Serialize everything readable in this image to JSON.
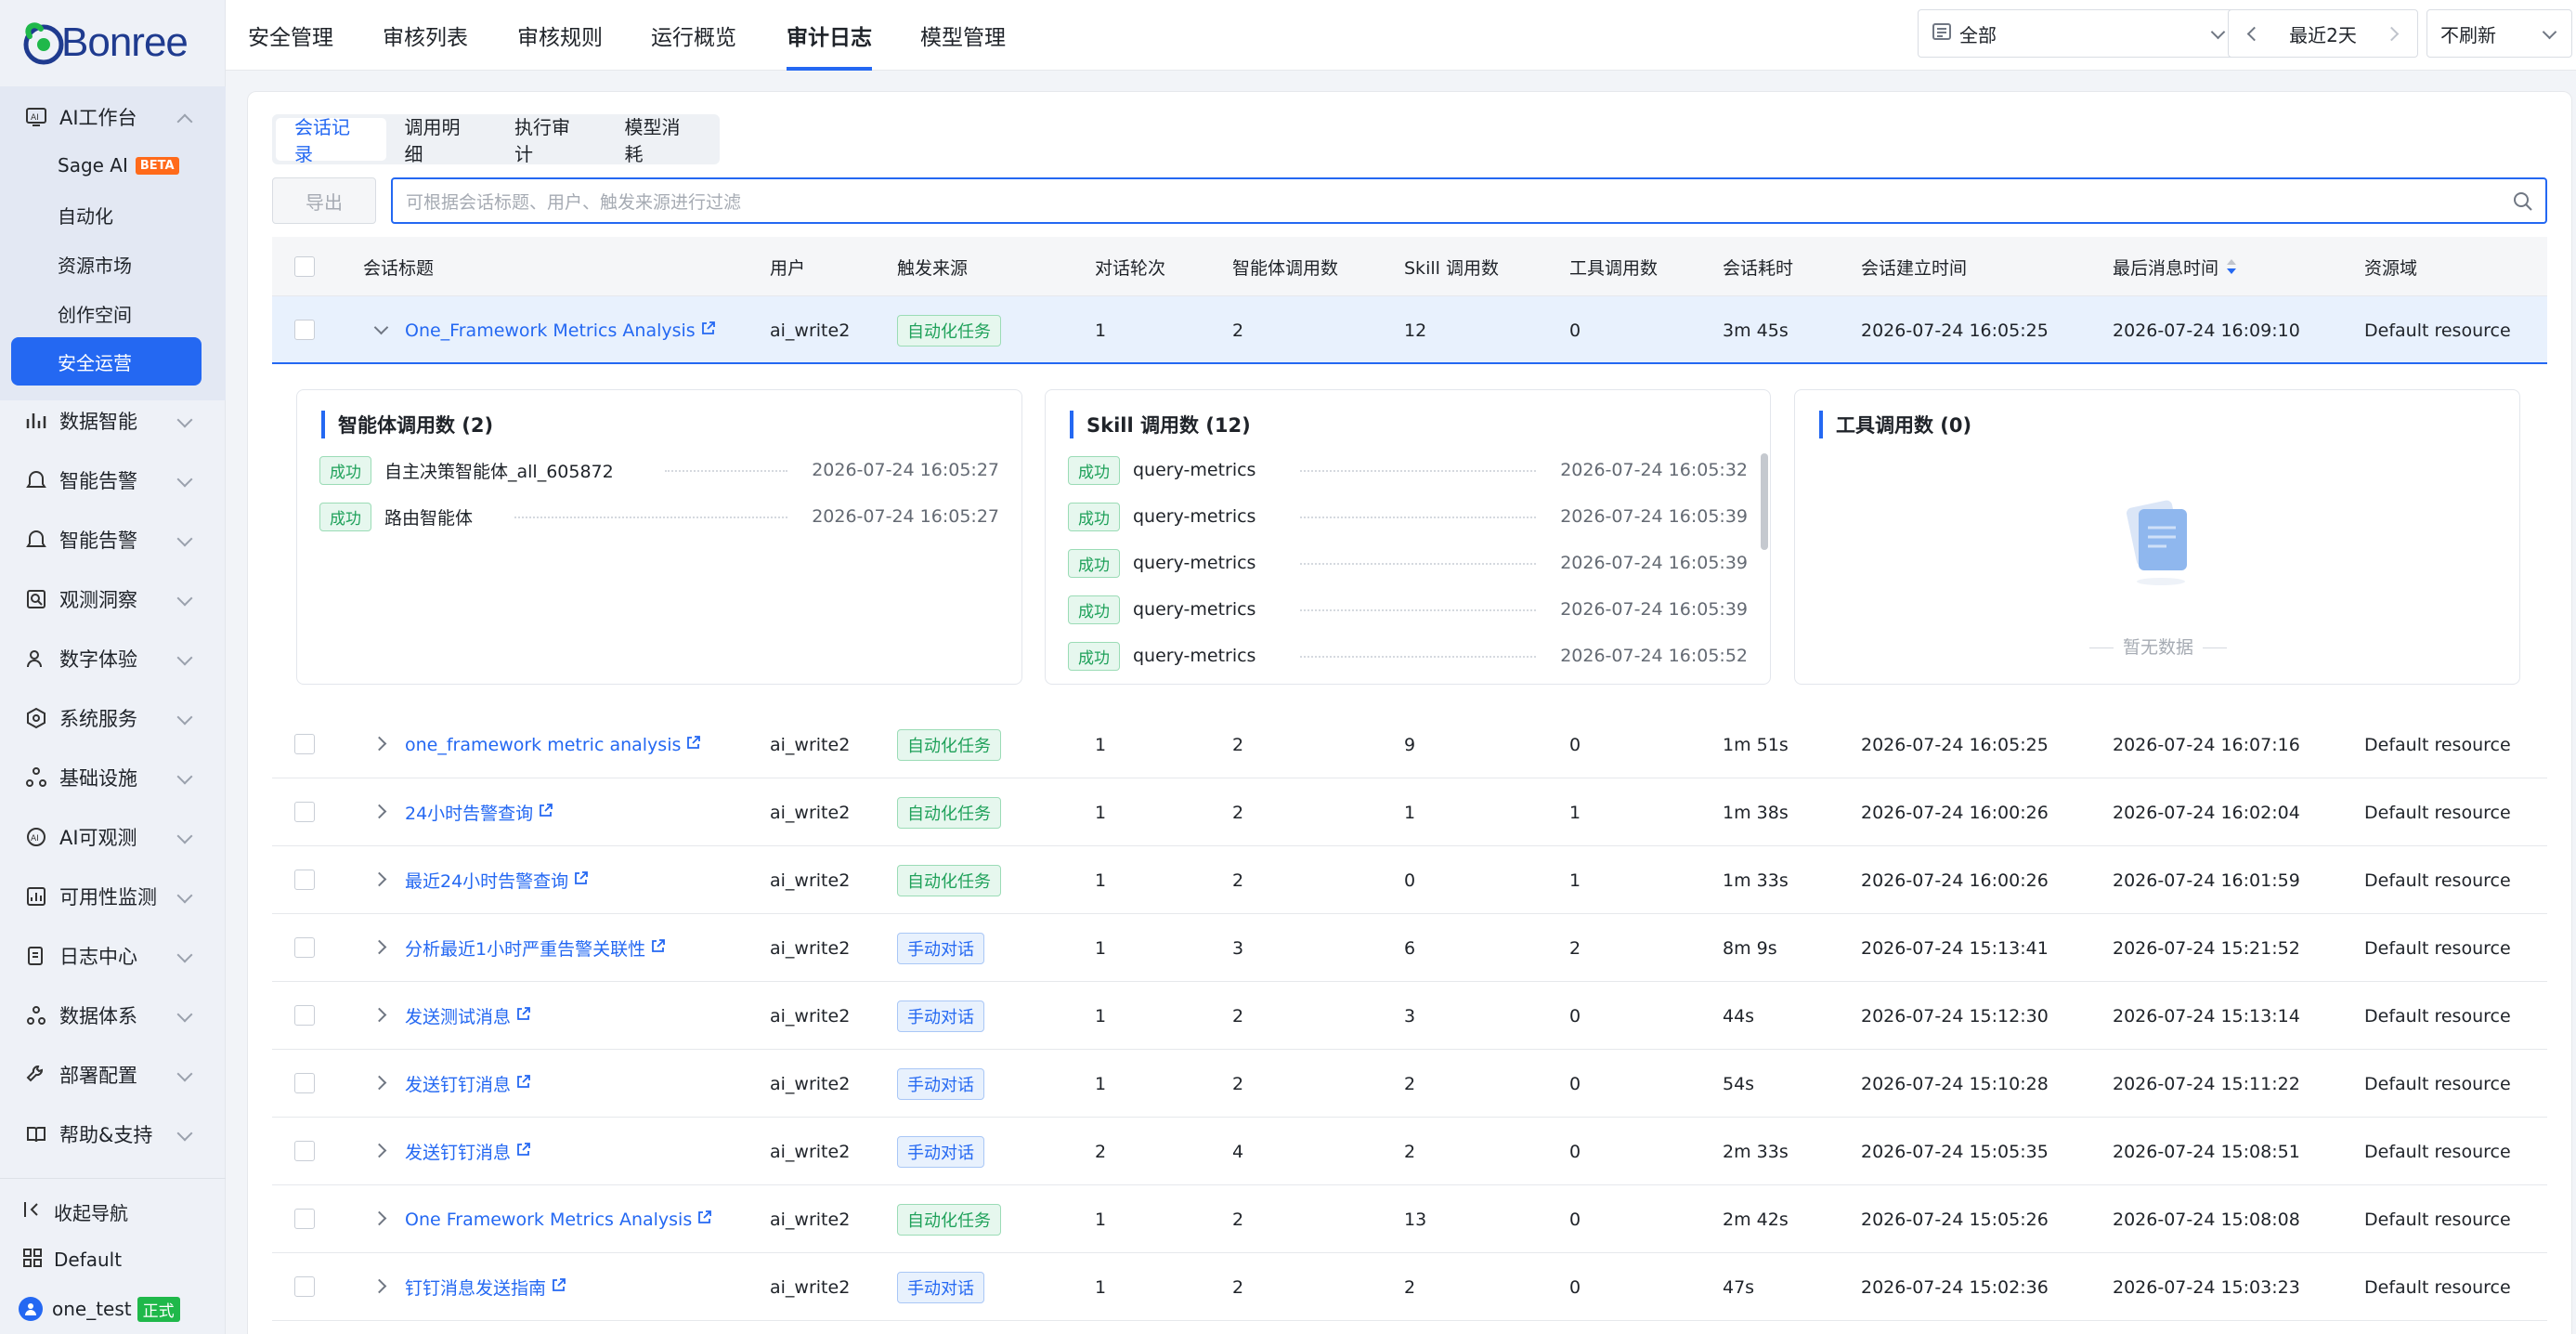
{
  "brand": {
    "name": "Bonree"
  },
  "sidebar": {
    "groups": [
      {
        "label": "AI工作台",
        "icon": "ai-workbench-icon",
        "expanded": true
      },
      {
        "label": "数据智能",
        "icon": "data-intel-icon"
      },
      {
        "label": "智能告警",
        "icon": "alert-icon"
      },
      {
        "label": "智能告警",
        "icon": "alert-icon"
      },
      {
        "label": "观测洞察",
        "icon": "insight-icon"
      },
      {
        "label": "数字体验",
        "icon": "digital-exp-icon"
      },
      {
        "label": "系统服务",
        "icon": "system-icon"
      },
      {
        "label": "基础设施",
        "icon": "infra-icon"
      },
      {
        "label": "AI可观测",
        "icon": "ai-observe-icon"
      },
      {
        "label": "可用性监测",
        "icon": "availability-icon"
      },
      {
        "label": "日志中心",
        "icon": "log-icon"
      },
      {
        "label": "数据体系",
        "icon": "data-system-icon"
      },
      {
        "label": "部署配置",
        "icon": "deploy-icon"
      },
      {
        "label": "帮助&支持",
        "icon": "help-icon"
      }
    ],
    "sub_items": [
      {
        "label": "Sage AI",
        "badge": "BETA"
      },
      {
        "label": "自动化"
      },
      {
        "label": "资源市场"
      },
      {
        "label": "创作空间"
      },
      {
        "label": "安全运营",
        "active": true
      }
    ],
    "collapse_label": "收起导航",
    "workspace_label": "Default",
    "user": {
      "name": "one_test",
      "badge": "正式"
    }
  },
  "topnav": {
    "tabs": [
      {
        "label": "安全管理"
      },
      {
        "label": "审核列表"
      },
      {
        "label": "审核规则"
      },
      {
        "label": "运行概览"
      },
      {
        "label": "审计日志",
        "active": true
      },
      {
        "label": "模型管理"
      }
    ],
    "scope_select": "全部",
    "time_range": "最近2天",
    "refresh_select": "不刷新"
  },
  "subtabs": [
    {
      "label": "会话记录",
      "active": true
    },
    {
      "label": "调用明细"
    },
    {
      "label": "执行审计"
    },
    {
      "label": "模型消耗"
    }
  ],
  "toolbar": {
    "export_label": "导出",
    "search_placeholder": "可根据会话标题、用户、触发来源进行过滤"
  },
  "table": {
    "columns": [
      "会话标题",
      "用户",
      "触发来源",
      "对话轮次",
      "智能体调用数",
      "Skill 调用数",
      "工具调用数",
      "会话耗时",
      "会话建立时间",
      "最后消息时间",
      "资源域"
    ],
    "sorted_column": "最后消息时间",
    "rows": [
      {
        "title": "One_Framework Metrics Analysis",
        "user": "ai_write2",
        "source": "自动化任务",
        "source_type": "auto",
        "turns": "1",
        "agents": "2",
        "skills": "12",
        "tools": "0",
        "duration": "3m 45s",
        "created": "2026-07-24 16:05:25",
        "last": "2026-07-24 16:09:10",
        "domain": "Default resource",
        "expanded": true
      },
      {
        "title": "one_framework metric analysis",
        "user": "ai_write2",
        "source": "自动化任务",
        "source_type": "auto",
        "turns": "1",
        "agents": "2",
        "skills": "9",
        "tools": "0",
        "duration": "1m 51s",
        "created": "2026-07-24 16:05:25",
        "last": "2026-07-24 16:07:16",
        "domain": "Default resource"
      },
      {
        "title": "24小时告警查询",
        "user": "ai_write2",
        "source": "自动化任务",
        "source_type": "auto",
        "turns": "1",
        "agents": "2",
        "skills": "1",
        "tools": "1",
        "duration": "1m 38s",
        "created": "2026-07-24 16:00:26",
        "last": "2026-07-24 16:02:04",
        "domain": "Default resource"
      },
      {
        "title": "最近24小时告警查询",
        "user": "ai_write2",
        "source": "自动化任务",
        "source_type": "auto",
        "turns": "1",
        "agents": "2",
        "skills": "0",
        "tools": "1",
        "duration": "1m 33s",
        "created": "2026-07-24 16:00:26",
        "last": "2026-07-24 16:01:59",
        "domain": "Default resource"
      },
      {
        "title": "分析最近1小时严重告警关联性",
        "user": "ai_write2",
        "source": "手动对话",
        "source_type": "manual",
        "turns": "1",
        "agents": "3",
        "skills": "6",
        "tools": "2",
        "duration": "8m 9s",
        "created": "2026-07-24 15:13:41",
        "last": "2026-07-24 15:21:52",
        "domain": "Default resource"
      },
      {
        "title": "发送测试消息",
        "user": "ai_write2",
        "source": "手动对话",
        "source_type": "manual",
        "turns": "1",
        "agents": "2",
        "skills": "3",
        "tools": "0",
        "duration": "44s",
        "created": "2026-07-24 15:12:30",
        "last": "2026-07-24 15:13:14",
        "domain": "Default resource"
      },
      {
        "title": "发送钉钉消息",
        "user": "ai_write2",
        "source": "手动对话",
        "source_type": "manual",
        "turns": "1",
        "agents": "2",
        "skills": "2",
        "tools": "0",
        "duration": "54s",
        "created": "2026-07-24 15:10:28",
        "last": "2026-07-24 15:11:22",
        "domain": "Default resource"
      },
      {
        "title": "发送钉钉消息",
        "user": "ai_write2",
        "source": "手动对话",
        "source_type": "manual",
        "turns": "2",
        "agents": "4",
        "skills": "2",
        "tools": "0",
        "duration": "2m 33s",
        "created": "2026-07-24 15:05:35",
        "last": "2026-07-24 15:08:51",
        "domain": "Default resource"
      },
      {
        "title": "One Framework Metrics Analysis",
        "user": "ai_write2",
        "source": "自动化任务",
        "source_type": "auto",
        "turns": "1",
        "agents": "2",
        "skills": "13",
        "tools": "0",
        "duration": "2m 42s",
        "created": "2026-07-24 15:05:26",
        "last": "2026-07-24 15:08:08",
        "domain": "Default resource"
      },
      {
        "title": "钉钉消息发送指南",
        "user": "ai_write2",
        "source": "手动对话",
        "source_type": "manual",
        "turns": "1",
        "agents": "2",
        "skills": "2",
        "tools": "0",
        "duration": "47s",
        "created": "2026-07-24 15:02:36",
        "last": "2026-07-24 15:03:23",
        "domain": "Default resource"
      }
    ]
  },
  "detail": {
    "agents": {
      "title": "智能体调用数 (2)",
      "items": [
        {
          "status": "成功",
          "name": "自主决策智能体_all_605872",
          "time": "2026-07-24 16:05:27"
        },
        {
          "status": "成功",
          "name": "路由智能体",
          "time": "2026-07-24 16:05:27"
        }
      ]
    },
    "skills": {
      "title": "Skill 调用数 (12)",
      "items": [
        {
          "status": "成功",
          "name": "query-metrics",
          "time": "2026-07-24 16:05:32"
        },
        {
          "status": "成功",
          "name": "query-metrics",
          "time": "2026-07-24 16:05:39"
        },
        {
          "status": "成功",
          "name": "query-metrics",
          "time": "2026-07-24 16:05:39"
        },
        {
          "status": "成功",
          "name": "query-metrics",
          "time": "2026-07-24 16:05:39"
        },
        {
          "status": "成功",
          "name": "query-metrics",
          "time": "2026-07-24 16:05:52"
        }
      ]
    },
    "tools": {
      "title": "工具调用数 (0)",
      "empty_text": "暂无数据"
    }
  },
  "colors": {
    "accent": "#2468f2",
    "success": "#1fa15a",
    "beta": "#ff6a1a",
    "prod": "#1fb84a"
  }
}
